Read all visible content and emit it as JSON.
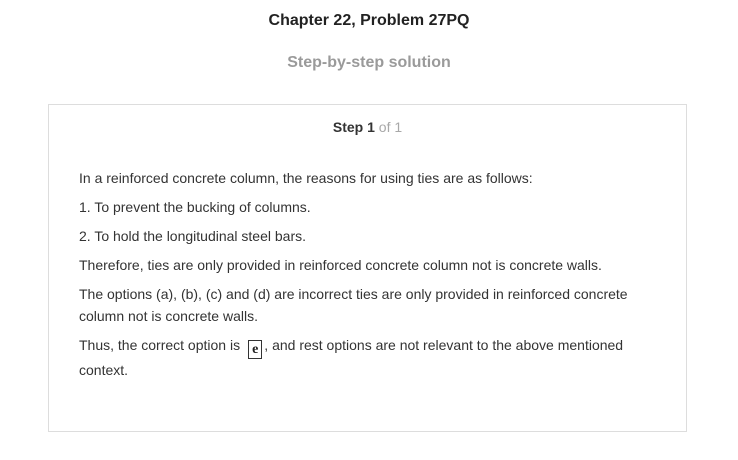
{
  "header": {
    "chapter_title": "Chapter 22, Problem 27PQ",
    "subtitle": "Step-by-step solution"
  },
  "step": {
    "label": "Step",
    "number": "1",
    "of_total": "of 1"
  },
  "content": {
    "intro": "In a reinforced concrete column, the reasons for using ties are as follows:",
    "reason_1": "1. To prevent the bucking of columns.",
    "reason_2": "2. To hold the longitudinal steel bars.",
    "therefore": "Therefore, ties are only provided in reinforced concrete column not is concrete walls.",
    "options_note": "The options (a), (b), (c) and (d) are incorrect ties are only provided in reinforced concrete column not is concrete walls.",
    "conclusion_prefix": "Thus, the correct option is",
    "answer": "e",
    "conclusion_suffix": ", and rest options are not relevant to the above mentioned context."
  }
}
